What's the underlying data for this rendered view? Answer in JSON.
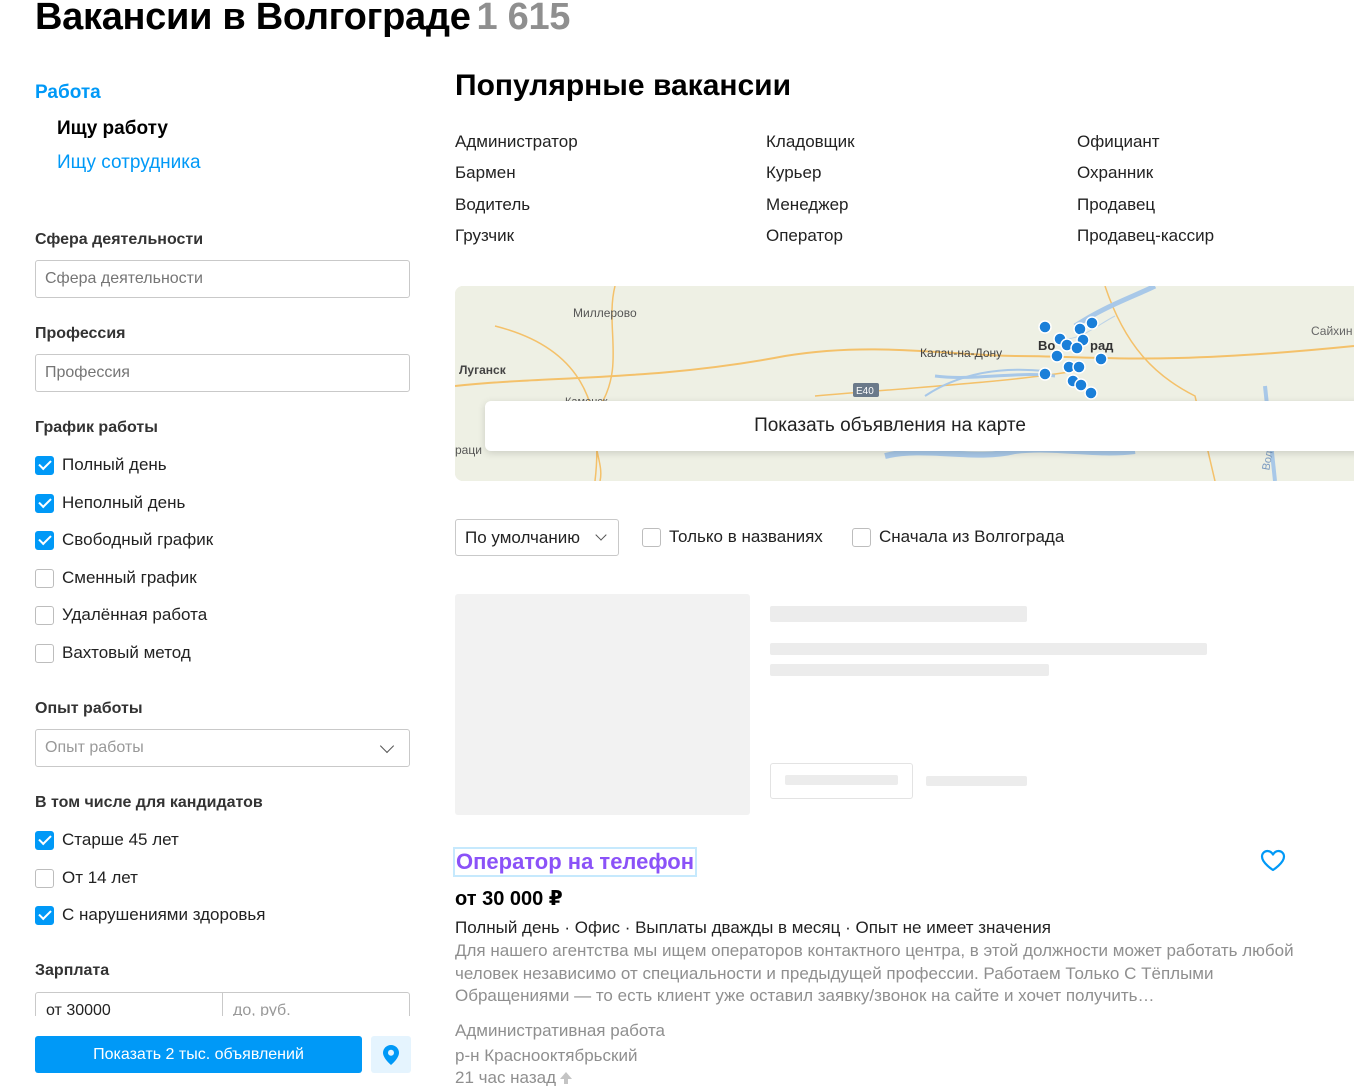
{
  "header": {
    "title": "Вакансии в Волгограде",
    "count": "1 615"
  },
  "sidebar": {
    "category": "Работа",
    "items": [
      {
        "label": "Ищу работу",
        "active": true
      },
      {
        "label": "Ищу сотрудника",
        "active": false
      }
    ],
    "sphere": {
      "label": "Сфера деятельности",
      "placeholder": "Сфера деятельности"
    },
    "profession": {
      "label": "Профессия",
      "placeholder": "Профессия"
    },
    "schedule": {
      "label": "График работы",
      "options": [
        {
          "label": "Полный день",
          "checked": true
        },
        {
          "label": "Неполный день",
          "checked": true
        },
        {
          "label": "Свободный график",
          "checked": true
        },
        {
          "label": "Сменный график",
          "checked": false
        },
        {
          "label": "Удалённая работа",
          "checked": false
        },
        {
          "label": "Вахтовый метод",
          "checked": false
        }
      ]
    },
    "experience": {
      "label": "Опыт работы",
      "placeholder": "Опыт работы"
    },
    "candidates": {
      "label": "В том числе для кандидатов",
      "options": [
        {
          "label": "Старше 45 лет",
          "checked": true
        },
        {
          "label": "От 14 лет",
          "checked": false
        },
        {
          "label": "С нарушениями здоровья",
          "checked": true
        }
      ]
    },
    "salary": {
      "label": "Зарплата",
      "from": "от 30000",
      "to_placeholder": "до, руб."
    },
    "show_button": "Показать 2 тыс. объявлений",
    "map_icon": "map-pin-icon"
  },
  "popular": {
    "title": "Популярные вакансии",
    "columns": [
      [
        "Администратор",
        "Бармен",
        "Водитель",
        "Грузчик"
      ],
      [
        "Кладовщик",
        "Курьер",
        "Менеджер",
        "Оператор"
      ],
      [
        "Официант",
        "Охранник",
        "Продавец",
        "Продавец-кассир"
      ]
    ]
  },
  "map": {
    "labels": {
      "millerovo": "Миллерово",
      "lugansk": "Луганск",
      "kalach": "Калач-на-Дону",
      "volgograd_a": "Во",
      "volgograd_b": "рад",
      "saykhin": "Сайхин",
      "kamensk": "Каменск",
      "road": "E40",
      "left_edge": "раци",
      "right_edge": "Вол"
    },
    "overlay_button": "Показать объявления на карте",
    "accent": "#1a7fd9"
  },
  "sort": {
    "selected": "По умолчанию",
    "only_titles": "Только в названиях",
    "volgograd_first": "Сначала из Волгограда"
  },
  "vacancy": {
    "title": "Оператор на телефон",
    "salary": "от 30 000 ₽",
    "tags": "Полный день · Офис · Выплаты дважды в месяц · Опыт не имеет значения",
    "description": "Для нашего агентства мы ищем операторов контактного центра, в этой должности может работать любой человек независимо от специальности и предыдущей профессии. Работаем Только С Тёплыми Обращениями — то есть клиент уже оставил заявку/звонок на сайте и хочет получить…",
    "category": "Административная работа",
    "district": "р-н Краснооктябрьский",
    "time": "21 час назад",
    "favorite_icon": "heart-icon",
    "promoted_icon": "arrow-up-icon"
  },
  "colors": {
    "accent": "#0099f7",
    "link_visited": "#8b52f8",
    "muted": "#8f8f8f"
  }
}
